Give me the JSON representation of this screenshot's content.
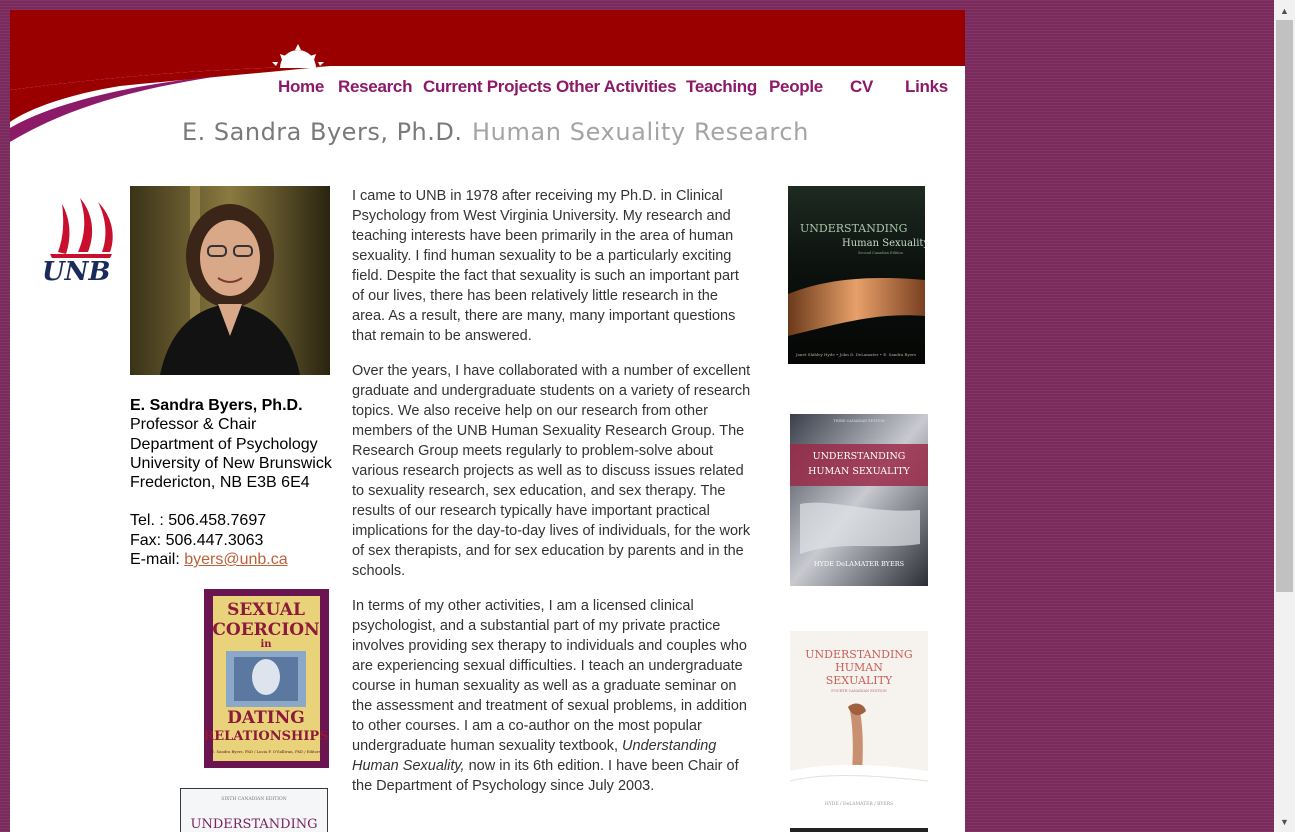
{
  "nav": {
    "items": [
      "Home",
      "Research",
      "Current Projects",
      "Other Activities",
      "Teaching",
      "People",
      "CV",
      "Links"
    ]
  },
  "header": {
    "name": "E. Sandra Byers, Ph.D.",
    "subtitle": "Human Sexuality Research"
  },
  "logo": {
    "text": "UNB"
  },
  "contact": {
    "name": "E. Sandra Byers, Ph.D.",
    "title": "Professor & Chair",
    "department": "Department of Psychology",
    "university": "University of New Brunswick",
    "address": "Fredericton, NB E3B 6E4",
    "tel": "Tel. : 506.458.7697",
    "fax": "Fax: 506.447.3063",
    "email_label": "E-mail: ",
    "email": "byers@unb.ca"
  },
  "bio": {
    "p1": "I came to UNB in 1978 after receiving my Ph.D. in Clinical Psychology from West Virginia University. My research and teaching interests have been primarily in the area of human sexuality. I find human sexuality to be a particularly exciting field. Despite the fact that sexuality is such an important part of our lives, there has been relatively little research in the area. As a result, there are many, many important questions that remain to be answered.",
    "p2": "Over the years, I have collaborated with a number of excellent graduate and undergraduate students on a variety of research topics. We also receive help on our research from other members of the UNB Human Sexuality Research Group. The Research Group meets regularly to problem-solve about various research projects as well as to discuss issues related to sexuality research, sex education, and sex therapy. The results of our research typically have important practical implications for the day-to-day lives of individuals, for the work of sex therapists, and for sex education by parents and in the schools.",
    "p3_before": "In terms of my other activities, I am a licensed clinical psychologist, and a substantial part of my private practice involves providing sex therapy to individuals and couples who are experiencing sexual difficulties. I teach an undergraduate course in human sexuality as well as a graduate seminar on the assessment and treatment of sexual problems, in addition to other courses. I am a co-author on the most popular undergraduate human sexuality textbook, ",
    "p3_italic": "Understanding Human Sexuality,",
    "p3_after": " now in its 6th edition. I have been Chair of the Department of Psychology since July 2003."
  },
  "books": {
    "coercion": {
      "title_top": "SEXUAL",
      "title_mid": "COERCION",
      "in": "in",
      "title_bottom": "DATING",
      "title_last": "RELATIONSHIPS",
      "editors": "E. Sandra Byers, PhD / Lucia F. O'Sullivan, PhD / Editors"
    },
    "bottom": {
      "edition": "SIXTH CANADIAN EDITION",
      "title": "UNDERSTANDING"
    },
    "book1": {
      "title1": "UNDERSTANDING",
      "title2": "Human Sexuality",
      "edition": "Second Canadian Edition",
      "authors": "Janet Shibley Hyde • John D. DeLamater • E. Sandra Byers"
    },
    "book2": {
      "edition": "THIRD CANADIAN EDITION",
      "title1": "UNDERSTANDING",
      "title2": "HUMAN SEXUALITY",
      "authors": "HYDE   DeLAMATER   BYERS"
    },
    "book3": {
      "title1": "UNDERSTANDING",
      "title2": "HUMAN",
      "title3": "SEXUALITY",
      "edition": "FOURTH CANADIAN EDITION",
      "authors": "HYDE / DeLAMATER / BYERS"
    }
  },
  "colors": {
    "banner": "#9b0000",
    "nav": "#8c1a68",
    "swoosh": "#8c1a68",
    "background": "#7a2a5c"
  },
  "scrollbar": {
    "up": "▲",
    "down": "▼"
  }
}
